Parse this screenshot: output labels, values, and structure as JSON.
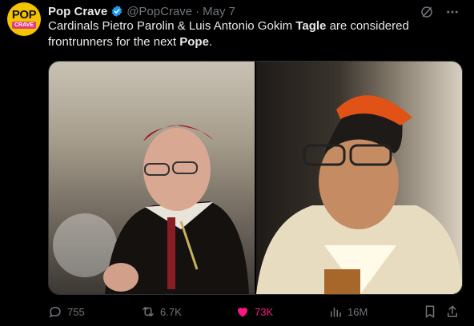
{
  "avatar": {
    "line1": "POP",
    "line2": "CRAVE"
  },
  "author": {
    "name": "Pop Crave",
    "handle": "@PopCrave",
    "separator": "·",
    "date": "May 7"
  },
  "tweet": {
    "segments": [
      {
        "text": "Cardinals Pietro Parolin & Luis Antonio Gokim ",
        "bold": false
      },
      {
        "text": "Tagle",
        "bold": true
      },
      {
        "text": " are considered frontrunners for the next ",
        "bold": false
      },
      {
        "text": "Pope",
        "bold": true
      },
      {
        "text": ".",
        "bold": false
      }
    ]
  },
  "actions": {
    "replies": "755",
    "reposts": "6.7K",
    "likes": "73K",
    "views": "16M"
  },
  "colors": {
    "like": "#f91880",
    "verified": "#1d9bf0",
    "muted": "#71767b"
  },
  "icons": [
    "verified-badge-icon",
    "grok-icon",
    "more-icon",
    "reply-icon",
    "repost-icon",
    "like-icon",
    "views-icon",
    "bookmark-icon",
    "share-icon"
  ]
}
